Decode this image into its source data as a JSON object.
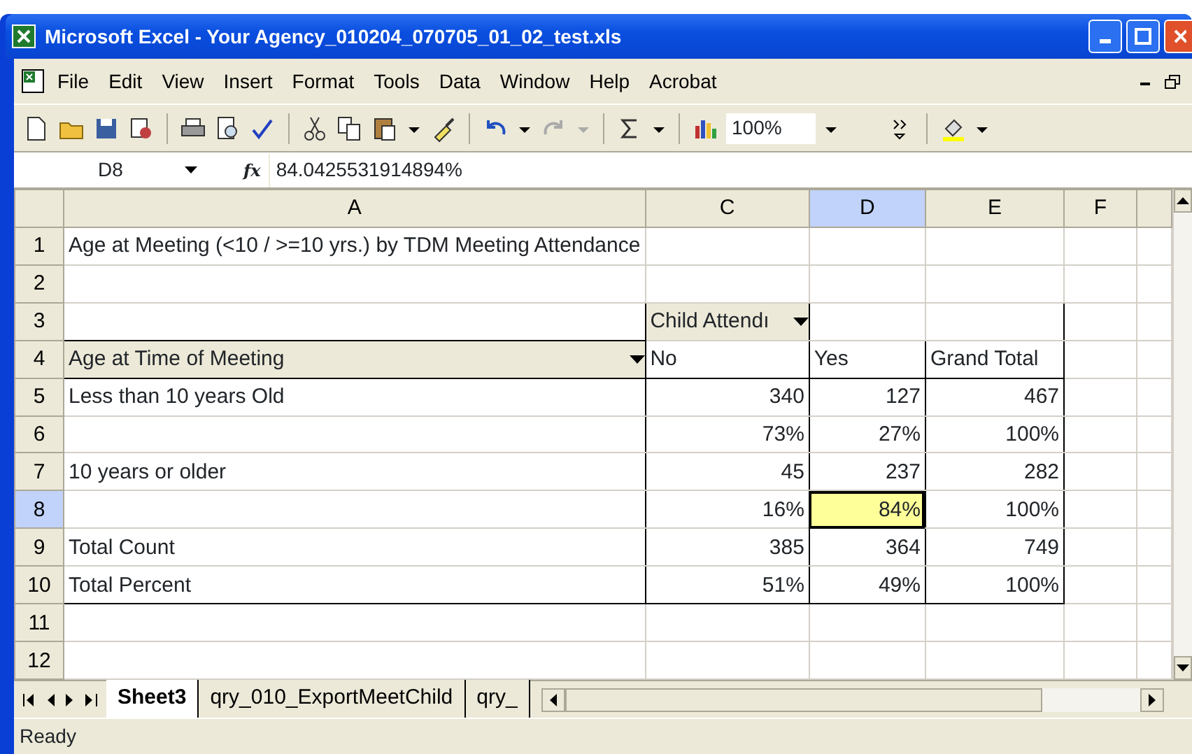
{
  "window": {
    "title": "Microsoft Excel - Your Agency_010204_070705_01_02_test.xls"
  },
  "menu": [
    "File",
    "Edit",
    "View",
    "Insert",
    "Format",
    "Tools",
    "Data",
    "Window",
    "Help",
    "Acrobat"
  ],
  "toolbar": {
    "zoom": "100%"
  },
  "formula_bar": {
    "name_box": "D8",
    "fx": "fx",
    "value": "84.0425531914894%"
  },
  "columns": [
    {
      "label": "A",
      "selected": false
    },
    {
      "label": "C",
      "selected": false
    },
    {
      "label": "D",
      "selected": true
    },
    {
      "label": "E",
      "selected": false
    },
    {
      "label": "F",
      "selected": false
    }
  ],
  "rows": [
    {
      "header": "1",
      "kind": "title",
      "selected": false,
      "cells": {
        "A": {
          "text": "Age at Meeting (<10 / >=10 yrs.) by TDM Meeting Attendance"
        }
      }
    },
    {
      "header": "2",
      "kind": "blank",
      "selected": false,
      "cells": {}
    },
    {
      "header": "3",
      "kind": "pivot-field",
      "selected": false,
      "cells": {
        "C": {
          "text": "Child Attendı",
          "dropdown": true
        }
      }
    },
    {
      "header": "4",
      "kind": "pivot-header",
      "selected": false,
      "cells": {
        "A": {
          "text": "Age at Time of Meeting",
          "dropdown": true
        },
        "C": {
          "text": "No"
        },
        "D": {
          "text": "Yes"
        },
        "E": {
          "text": "Grand Total"
        }
      }
    },
    {
      "header": "5",
      "kind": "count",
      "selected": false,
      "cells": {
        "A": {
          "text": "Less than 10 years Old"
        },
        "C": {
          "text": "340"
        },
        "D": {
          "text": "127"
        },
        "E": {
          "text": "467"
        }
      }
    },
    {
      "header": "6",
      "kind": "percent",
      "selected": false,
      "cells": {
        "C": {
          "text": "73%"
        },
        "D": {
          "text": "27%"
        },
        "E": {
          "text": "100%"
        }
      }
    },
    {
      "header": "7",
      "kind": "count",
      "selected": false,
      "cells": {
        "A": {
          "text": "10 years or older"
        },
        "C": {
          "text": "45"
        },
        "D": {
          "text": "237"
        },
        "E": {
          "text": "282"
        }
      }
    },
    {
      "header": "8",
      "kind": "percent",
      "selected": true,
      "cells": {
        "C": {
          "text": "16%"
        },
        "D": {
          "text": "84%"
        },
        "E": {
          "text": "100%"
        }
      }
    },
    {
      "header": "9",
      "kind": "total",
      "selected": false,
      "cells": {
        "A": {
          "text": "Total Count"
        },
        "C": {
          "text": "385"
        },
        "D": {
          "text": "364"
        },
        "E": {
          "text": "749"
        }
      }
    },
    {
      "header": "10",
      "kind": "total",
      "selected": false,
      "cells": {
        "A": {
          "text": "Total Percent"
        },
        "C": {
          "text": "51%"
        },
        "D": {
          "text": "49%"
        },
        "E": {
          "text": "100%"
        }
      }
    },
    {
      "header": "11",
      "kind": "blank",
      "selected": false,
      "cells": {}
    },
    {
      "header": "12",
      "kind": "blank",
      "selected": false,
      "cells": {}
    }
  ],
  "sheet_tabs": [
    {
      "label": "Sheet3",
      "selected": true
    },
    {
      "label": "qry_010_ExportMeetChild",
      "selected": false
    },
    {
      "label": "qry_",
      "selected": false
    }
  ],
  "status_bar": "Ready"
}
